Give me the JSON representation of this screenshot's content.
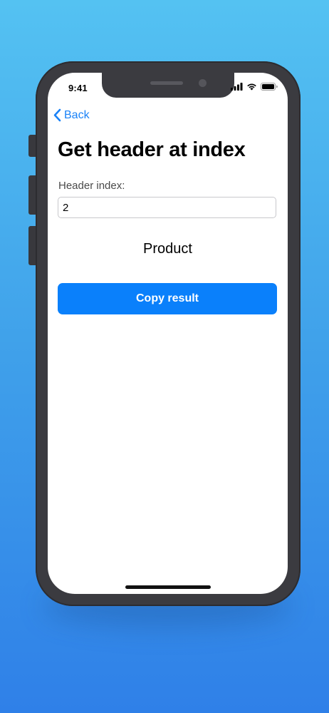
{
  "status_bar": {
    "time": "9:41",
    "icons": [
      "cellular-signal-icon",
      "wifi-icon",
      "battery-icon"
    ]
  },
  "nav": {
    "back_label": "Back",
    "back_icon": "chevron-left-icon"
  },
  "page": {
    "title": "Get header at index"
  },
  "form": {
    "index_label": "Header index:",
    "index_value": "2"
  },
  "result": {
    "text": "Product"
  },
  "actions": {
    "copy_label": "Copy result"
  },
  "colors": {
    "accent": "#0a80fb",
    "background_top": "#54c2f2",
    "background_bottom": "#2f80e8",
    "device_frame": "#3b3b40"
  }
}
